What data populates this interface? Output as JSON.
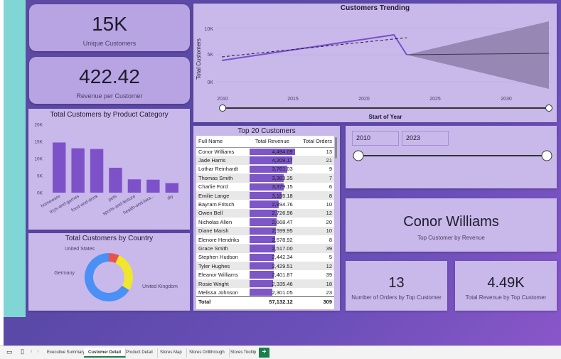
{
  "kpis": {
    "unique_customers": {
      "value": "15K",
      "label": "Unique Customers"
    },
    "revenue_per_customer": {
      "value": "422.42",
      "label": "Revenue per Customer"
    },
    "top_customer": {
      "value": "Conor Williams",
      "label": "Top Customer by Revenue"
    },
    "orders_top_customer": {
      "value": "13",
      "label": "Number of Orders by Top Customer"
    },
    "revenue_top_customer": {
      "value": "4.49K",
      "label": "Total Revenue by Top Customer"
    }
  },
  "year_slicer": {
    "start": "2010",
    "end": "2023"
  },
  "trend_chart": {
    "title": "Customers Trending",
    "y_title": "Total Customers",
    "x_title": "Start of Year",
    "y_ticks": [
      "10K",
      "5K",
      "0K"
    ],
    "x_ticks": [
      "2010",
      "2015",
      "2020",
      "2025",
      "2030"
    ]
  },
  "category_chart": {
    "title": "Total Customers by Product Category",
    "y_ticks": [
      "20K",
      "15K",
      "10K",
      "5K",
      "0K"
    ],
    "categories": [
      "homeware",
      "toys-and-games",
      "food-and-drink",
      "pets",
      "sports-and-leisure",
      "health-and-bea...",
      "diy"
    ]
  },
  "country_chart": {
    "title": "Total Customers by Country",
    "labels": [
      "United States",
      "Germany",
      "United Kingdom"
    ]
  },
  "top20": {
    "title": "Top 20 Customers",
    "columns": [
      "Full Name",
      "Total Revenue",
      "Total Orders"
    ],
    "rows": [
      {
        "name": "Conor Williams",
        "revenue": "4,494.09",
        "orders": "13"
      },
      {
        "name": "Jade Harris",
        "revenue": "4,209.17",
        "orders": "21"
      },
      {
        "name": "Lothar Reinhardt",
        "revenue": "3,761.03",
        "orders": "9"
      },
      {
        "name": "Thomas Smith",
        "revenue": "3,383.35",
        "orders": "7"
      },
      {
        "name": "Charlie Ford",
        "revenue": "3,379.15",
        "orders": "6"
      },
      {
        "name": "Emilie Lange",
        "revenue": "3,185.18",
        "orders": "8"
      },
      {
        "name": "Bayram Fritsch",
        "revenue": "2,894.76",
        "orders": "10"
      },
      {
        "name": "Owen Bell",
        "revenue": "2,726.96",
        "orders": "12"
      },
      {
        "name": "Nicholas Allen",
        "revenue": "2,668.47",
        "orders": "20"
      },
      {
        "name": "Diane Marsh",
        "revenue": "2,599.95",
        "orders": "10"
      },
      {
        "name": "Elenore Hendriks",
        "revenue": "2,578.92",
        "orders": "8"
      },
      {
        "name": "Grace Smith",
        "revenue": "2,517.00",
        "orders": "39"
      },
      {
        "name": "Stephen Hudson",
        "revenue": "2,442.34",
        "orders": "5"
      },
      {
        "name": "Tyler Hughes",
        "revenue": "2,429.51",
        "orders": "12"
      },
      {
        "name": "Eleanor Williams",
        "revenue": "2,401.87",
        "orders": "39"
      },
      {
        "name": "Rosie Wright",
        "revenue": "2,335.46",
        "orders": "18"
      },
      {
        "name": "Melissa Johnson",
        "revenue": "2,301.05",
        "orders": "23"
      }
    ],
    "total_label": "Total",
    "total_revenue": "57,132.12",
    "total_orders": "309"
  },
  "tabs": [
    "Executive Summary",
    "Customer Detail",
    "Product Detail",
    "Stores Map",
    "Stores Drillthrough",
    "Stores Tooltip"
  ],
  "add_tab_label": "+",
  "chart_data": [
    {
      "type": "line",
      "x": [
        2010,
        2021.5,
        2023,
        2033
      ],
      "series": [],
      "xlim": [
        2009,
        2034
      ],
      "ylim": [
        0,
        12000
      ],
      "note_values": {
        "actual_start": 4100,
        "actual_peak": 8600,
        "actual_end": 5300
      }
    },
    {
      "type": "bar",
      "categories": [
        "homeware",
        "toys-and-games",
        "food-and-drink",
        "pets",
        "sports-and-leisure",
        "health-and-bea...",
        "diy"
      ],
      "values": [
        14700,
        13000,
        12800,
        7300,
        3900,
        3800,
        2800
      ],
      "ylim": [
        0,
        20000
      ]
    },
    {
      "type": "pie",
      "categories": [
        "United States",
        "Germany",
        "United Kingdom"
      ],
      "values": [
        7,
        27,
        66
      ]
    }
  ]
}
